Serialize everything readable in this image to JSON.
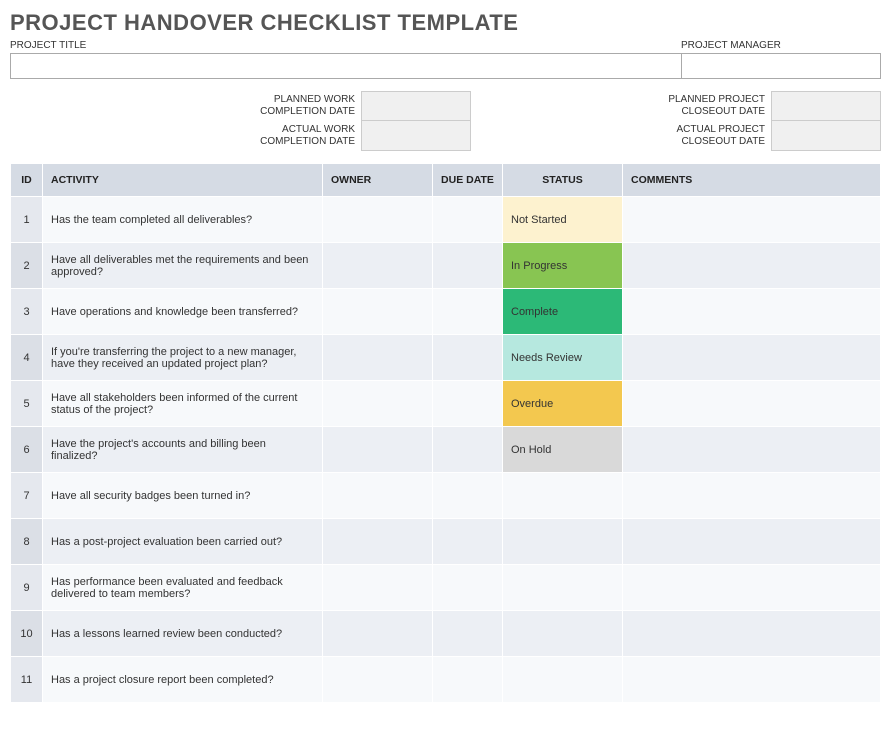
{
  "title": "PROJECT HANDOVER CHECKLIST TEMPLATE",
  "fields": {
    "project_title_label": "PROJECT TITLE",
    "project_title_value": "",
    "project_manager_label": "PROJECT MANAGER",
    "project_manager_value": "",
    "planned_work_label": "PLANNED WORK COMPLETION DATE",
    "planned_work_value": "",
    "actual_work_label": "ACTUAL WORK COMPLETION DATE",
    "actual_work_value": "",
    "planned_closeout_label": "PLANNED PROJECT CLOSEOUT DATE",
    "planned_closeout_value": "",
    "actual_closeout_label": "ACTUAL PROJECT CLOSEOUT DATE",
    "actual_closeout_value": ""
  },
  "columns": {
    "id": "ID",
    "activity": "ACTIVITY",
    "owner": "OWNER",
    "due": "DUE DATE",
    "status": "STATUS",
    "comments": "COMMENTS"
  },
  "status_colors": {
    "Not Started": "#fdf2cf",
    "In Progress": "#88c552",
    "Complete": "#2cb977",
    "Needs Review": "#b6e8df",
    "Overdue": "#f3c84f",
    "On Hold": "#d9d9d9"
  },
  "rows": [
    {
      "id": "1",
      "activity": "Has the team completed all deliverables?",
      "owner": "",
      "due": "",
      "status": "Not Started",
      "comments": ""
    },
    {
      "id": "2",
      "activity": "Have all deliverables met the requirements and been approved?",
      "owner": "",
      "due": "",
      "status": "In Progress",
      "comments": ""
    },
    {
      "id": "3",
      "activity": "Have operations and knowledge been transferred?",
      "owner": "",
      "due": "",
      "status": "Complete",
      "comments": ""
    },
    {
      "id": "4",
      "activity": "If you're transferring the project to a new manager, have they received an updated project plan?",
      "owner": "",
      "due": "",
      "status": "Needs Review",
      "comments": ""
    },
    {
      "id": "5",
      "activity": "Have all stakeholders been informed of the current status of the project?",
      "owner": "",
      "due": "",
      "status": "Overdue",
      "comments": ""
    },
    {
      "id": "6",
      "activity": "Have the project's accounts and billing been finalized?",
      "owner": "",
      "due": "",
      "status": "On Hold",
      "comments": ""
    },
    {
      "id": "7",
      "activity": "Have all security badges been turned in?",
      "owner": "",
      "due": "",
      "status": "",
      "comments": ""
    },
    {
      "id": "8",
      "activity": "Has a post-project evaluation been carried out?",
      "owner": "",
      "due": "",
      "status": "",
      "comments": ""
    },
    {
      "id": "9",
      "activity": "Has performance been evaluated and feedback delivered to team members?",
      "owner": "",
      "due": "",
      "status": "",
      "comments": ""
    },
    {
      "id": "10",
      "activity": "Has a lessons learned review been conducted?",
      "owner": "",
      "due": "",
      "status": "",
      "comments": ""
    },
    {
      "id": "11",
      "activity": "Has a project closure report been completed?",
      "owner": "",
      "due": "",
      "status": "",
      "comments": ""
    }
  ]
}
